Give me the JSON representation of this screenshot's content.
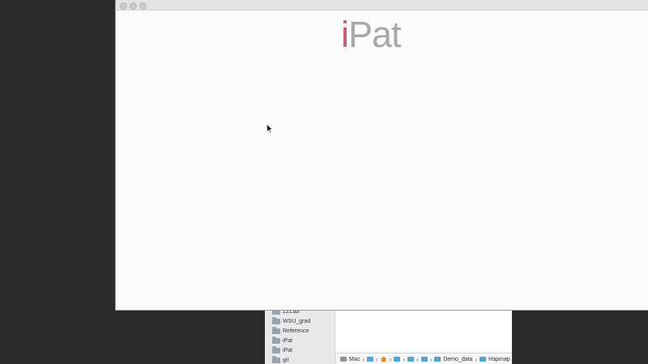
{
  "finder": {
    "sidebar_items": [
      {
        "label": "ZZLab",
        "icon": "folder-icon"
      },
      {
        "label": "WSU_grad",
        "icon": "folder-icon"
      },
      {
        "label": "Reference",
        "icon": "folder-icon"
      },
      {
        "label": "iPat",
        "icon": "folder-icon"
      },
      {
        "label": "iPat",
        "icon": "folder-icon"
      },
      {
        "label": "git",
        "icon": "folder-icon"
      }
    ],
    "pathbar": {
      "disk_label": "Mac",
      "folder1": "Demo_data",
      "folder2": "Hapmap"
    }
  },
  "ipat": {
    "logo_i": "i",
    "logo_pat": "Pat"
  },
  "colors": {
    "logo_accent": "#c0616e",
    "logo_gray": "#a8a8a8",
    "desktop": "#2b2b2d"
  }
}
